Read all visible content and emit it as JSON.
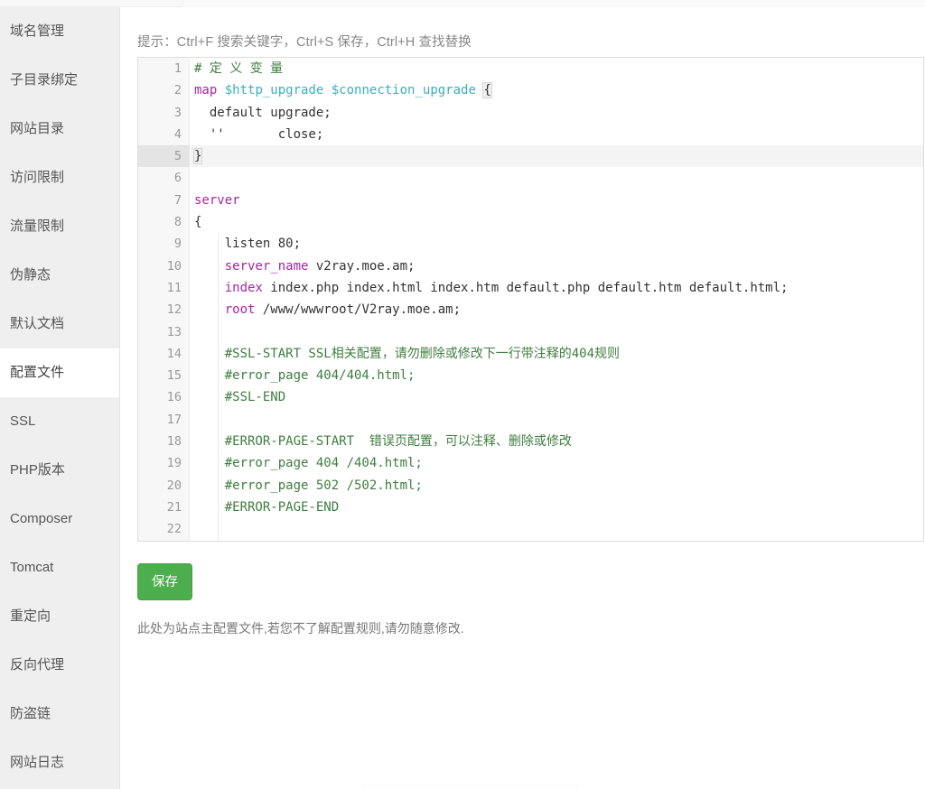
{
  "sidebar": {
    "items": [
      {
        "label": "域名管理",
        "active": false
      },
      {
        "label": "子目录绑定",
        "active": false
      },
      {
        "label": "网站目录",
        "active": false
      },
      {
        "label": "访问限制",
        "active": false
      },
      {
        "label": "流量限制",
        "active": false
      },
      {
        "label": "伪静态",
        "active": false
      },
      {
        "label": "默认文档",
        "active": false
      },
      {
        "label": "配置文件",
        "active": true
      },
      {
        "label": "SSL",
        "active": false
      },
      {
        "label": "PHP版本",
        "active": false
      },
      {
        "label": "Composer",
        "active": false
      },
      {
        "label": "Tomcat",
        "active": false
      },
      {
        "label": "重定向",
        "active": false
      },
      {
        "label": "反向代理",
        "active": false
      },
      {
        "label": "防盗链",
        "active": false
      },
      {
        "label": "网站日志",
        "active": false
      }
    ]
  },
  "main": {
    "hint": "提示：Ctrl+F 搜索关键字，Ctrl+S 保存，Ctrl+H 查找替换",
    "save_label": "保存",
    "footnote": "此处为站点主配置文件,若您不了解配置规则,请勿随意修改."
  },
  "editor": {
    "active_line": 5,
    "cursor_line": 5,
    "total_lines": 22,
    "colors": {
      "comment": "#3f7d3f",
      "keyword": "#a626a4",
      "variable": "#3daebd",
      "text": "#333333",
      "gutter_bg": "#f7f7f7",
      "active_line_bg": "#f4f4f4",
      "border": "#dddddd"
    },
    "lines": [
      {
        "n": 1,
        "indent": 0,
        "tokens": [
          {
            "t": "com",
            "v": "# 定 义 变 量"
          }
        ]
      },
      {
        "n": 2,
        "indent": 0,
        "tokens": [
          {
            "t": "kw",
            "v": "map"
          },
          {
            "t": "txt",
            "v": " "
          },
          {
            "t": "var",
            "v": "$http_upgrade"
          },
          {
            "t": "txt",
            "v": " "
          },
          {
            "t": "var",
            "v": "$connection_upgrade"
          },
          {
            "t": "txt",
            "v": " "
          },
          {
            "t": "brace",
            "v": "{"
          }
        ]
      },
      {
        "n": 3,
        "indent": 0,
        "tokens": [
          {
            "t": "txt",
            "v": "  default upgrade;"
          }
        ]
      },
      {
        "n": 4,
        "indent": 0,
        "tokens": [
          {
            "t": "txt",
            "v": "  ''       close;"
          }
        ]
      },
      {
        "n": 5,
        "indent": 0,
        "tokens": [
          {
            "t": "brace",
            "v": "}"
          },
          {
            "t": "cursor",
            "v": ""
          }
        ]
      },
      {
        "n": 6,
        "indent": 0,
        "tokens": []
      },
      {
        "n": 7,
        "indent": 0,
        "tokens": [
          {
            "t": "kw",
            "v": "server"
          }
        ]
      },
      {
        "n": 8,
        "indent": 0,
        "tokens": [
          {
            "t": "txt",
            "v": "{"
          }
        ]
      },
      {
        "n": 9,
        "indent": 1,
        "tokens": [
          {
            "t": "txt",
            "v": "    listen 80;"
          }
        ]
      },
      {
        "n": 10,
        "indent": 1,
        "tokens": [
          {
            "t": "txt",
            "v": "    "
          },
          {
            "t": "kw",
            "v": "server_name"
          },
          {
            "t": "txt",
            "v": " v2ray.moe.am;"
          }
        ]
      },
      {
        "n": 11,
        "indent": 1,
        "tokens": [
          {
            "t": "txt",
            "v": "    "
          },
          {
            "t": "kw",
            "v": "index"
          },
          {
            "t": "txt",
            "v": " index.php index.html index.htm default.php default.htm default.html;"
          }
        ]
      },
      {
        "n": 12,
        "indent": 1,
        "tokens": [
          {
            "t": "txt",
            "v": "    "
          },
          {
            "t": "kw",
            "v": "root"
          },
          {
            "t": "txt",
            "v": " /www/wwwroot/V2ray.moe.am;"
          }
        ]
      },
      {
        "n": 13,
        "indent": 1,
        "tokens": []
      },
      {
        "n": 14,
        "indent": 1,
        "tokens": [
          {
            "t": "txt",
            "v": "    "
          },
          {
            "t": "com",
            "v": "#SSL-START SSL相关配置，请勿删除或修改下一行带注释的404规则"
          }
        ]
      },
      {
        "n": 15,
        "indent": 1,
        "tokens": [
          {
            "t": "txt",
            "v": "    "
          },
          {
            "t": "com",
            "v": "#error_page 404/404.html;"
          }
        ]
      },
      {
        "n": 16,
        "indent": 1,
        "tokens": [
          {
            "t": "txt",
            "v": "    "
          },
          {
            "t": "com",
            "v": "#SSL-END"
          }
        ]
      },
      {
        "n": 17,
        "indent": 1,
        "tokens": []
      },
      {
        "n": 18,
        "indent": 1,
        "tokens": [
          {
            "t": "txt",
            "v": "    "
          },
          {
            "t": "com",
            "v": "#ERROR-PAGE-START  错误页配置，可以注释、删除或修改"
          }
        ]
      },
      {
        "n": 19,
        "indent": 1,
        "tokens": [
          {
            "t": "txt",
            "v": "    "
          },
          {
            "t": "com",
            "v": "#error_page 404 /404.html;"
          }
        ]
      },
      {
        "n": 20,
        "indent": 1,
        "tokens": [
          {
            "t": "txt",
            "v": "    "
          },
          {
            "t": "com",
            "v": "#error_page 502 /502.html;"
          }
        ]
      },
      {
        "n": 21,
        "indent": 1,
        "tokens": [
          {
            "t": "txt",
            "v": "    "
          },
          {
            "t": "com",
            "v": "#ERROR-PAGE-END"
          }
        ]
      },
      {
        "n": 22,
        "indent": 1,
        "tokens": []
      }
    ]
  }
}
